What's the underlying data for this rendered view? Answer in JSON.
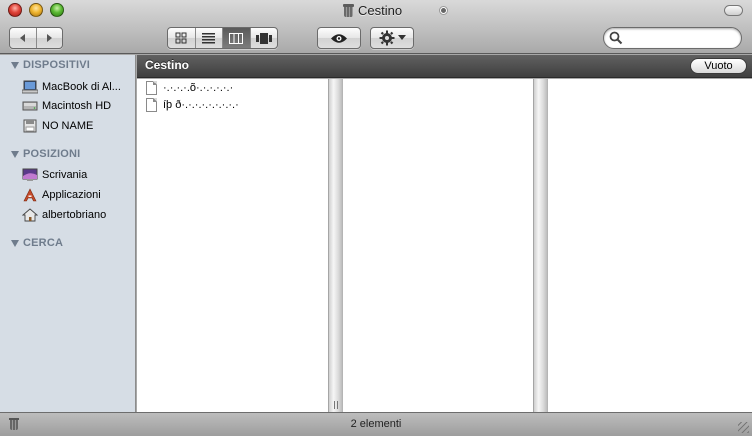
{
  "window": {
    "title": "Cestino"
  },
  "search": {
    "placeholder": "",
    "value": ""
  },
  "sidebar": {
    "sections": [
      {
        "label": "DISPOSITIVI",
        "items": [
          {
            "label": "MacBook di Al...",
            "icon": "laptop-icon"
          },
          {
            "label": "Macintosh HD",
            "icon": "hard-drive-icon"
          },
          {
            "label": "NO NAME",
            "icon": "disk-icon"
          }
        ]
      },
      {
        "label": "POSIZIONI",
        "items": [
          {
            "label": "Scrivania",
            "icon": "desktop-icon"
          },
          {
            "label": "Applicazioni",
            "icon": "applications-icon"
          },
          {
            "label": "albertobriano",
            "icon": "home-icon"
          }
        ]
      },
      {
        "label": "CERCA",
        "items": []
      }
    ]
  },
  "content": {
    "header_label": "Cestino",
    "empty_button": "Vuoto",
    "files": [
      {
        "name": "·.·.·.·.õ·.·.·.·.·.·",
        "icon": "document-icon"
      },
      {
        "name": "íþ ð·.·.·.·.·.·.·.·.·",
        "icon": "document-icon"
      }
    ]
  },
  "status": {
    "text": "2 elementi"
  },
  "colors": {
    "sidebar_bg": "#d6dde5",
    "section_header": "#6f7c8c",
    "content_header": "#4f4f4f"
  }
}
